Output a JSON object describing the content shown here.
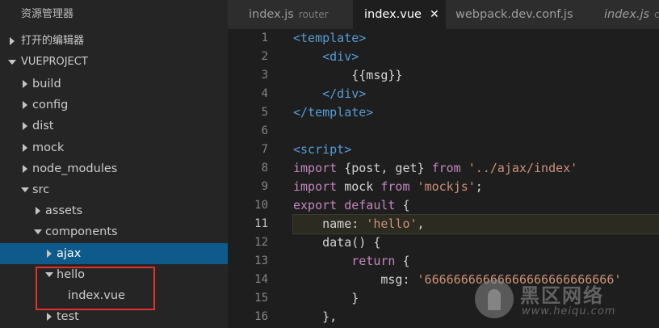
{
  "sidebar": {
    "title": "资源管理器",
    "open_editors": "打开的编辑器",
    "project": "VUEPROJECT",
    "tree": [
      {
        "label": "build",
        "state": "collapsed"
      },
      {
        "label": "config",
        "state": "collapsed"
      },
      {
        "label": "dist",
        "state": "collapsed"
      },
      {
        "label": "mock",
        "state": "collapsed"
      },
      {
        "label": "node_modules",
        "state": "collapsed"
      },
      {
        "label": "src",
        "state": "expanded"
      },
      {
        "label": "assets",
        "state": "collapsed"
      },
      {
        "label": "components",
        "state": "expanded"
      },
      {
        "label": "ajax",
        "state": "collapsed",
        "selected": true
      },
      {
        "label": "hello",
        "state": "expanded"
      },
      {
        "label": "index.vue",
        "state": "file"
      },
      {
        "label": "test",
        "state": "collapsed"
      }
    ]
  },
  "tabs": [
    {
      "label": "index.js",
      "desc": "router"
    },
    {
      "label": "index.vue",
      "close": "✕",
      "active": true
    },
    {
      "label": "webpack.dev.conf.js"
    },
    {
      "label": "index.js",
      "desc": "co"
    }
  ],
  "editor": {
    "current_line": 11,
    "lines": [
      {
        "n": "1",
        "t": [
          [
            "tag",
            "<template>"
          ]
        ]
      },
      {
        "n": "2",
        "t": [
          [
            "plain",
            "    "
          ],
          [
            "tag",
            "<div>"
          ]
        ]
      },
      {
        "n": "3",
        "t": [
          [
            "plain",
            "        {{msg}}"
          ]
        ]
      },
      {
        "n": "4",
        "t": [
          [
            "plain",
            "    "
          ],
          [
            "tag",
            "</div>"
          ]
        ]
      },
      {
        "n": "5",
        "t": [
          [
            "tag",
            "</template>"
          ]
        ]
      },
      {
        "n": "6",
        "t": []
      },
      {
        "n": "7",
        "t": [
          [
            "tag",
            "<script>"
          ]
        ]
      },
      {
        "n": "8",
        "t": [
          [
            "kw",
            "import"
          ],
          [
            "plain",
            " {post, get} "
          ],
          [
            "kw",
            "from"
          ],
          [
            "plain",
            " "
          ],
          [
            "str",
            "'../ajax/index'"
          ]
        ]
      },
      {
        "n": "9",
        "t": [
          [
            "kw",
            "import"
          ],
          [
            "plain",
            " mock "
          ],
          [
            "kw",
            "from"
          ],
          [
            "plain",
            " "
          ],
          [
            "str",
            "'mockjs'"
          ],
          [
            "plain",
            ";"
          ]
        ]
      },
      {
        "n": "10",
        "t": [
          [
            "kw",
            "export"
          ],
          [
            "plain",
            " "
          ],
          [
            "kw",
            "default"
          ],
          [
            "plain",
            " {"
          ]
        ]
      },
      {
        "n": "11",
        "t": [
          [
            "plain",
            "    name: "
          ],
          [
            "str",
            "'hello'"
          ],
          [
            "plain",
            ","
          ]
        ]
      },
      {
        "n": "12",
        "t": [
          [
            "plain",
            "    data() {"
          ]
        ]
      },
      {
        "n": "13",
        "t": [
          [
            "plain",
            "        "
          ],
          [
            "ctrl",
            "return"
          ],
          [
            "plain",
            " {"
          ]
        ]
      },
      {
        "n": "14",
        "t": [
          [
            "plain",
            "            msg: "
          ],
          [
            "str",
            "'66666666666666666666666666'"
          ]
        ]
      },
      {
        "n": "15",
        "t": [
          [
            "plain",
            "        }"
          ]
        ]
      },
      {
        "n": "16",
        "t": [
          [
            "plain",
            "    },"
          ]
        ]
      }
    ]
  },
  "watermark": {
    "text": "黑区网络",
    "sub": "www.heiqu.com"
  },
  "colors": {
    "selected": "#0e5a8a",
    "highlight_box": "#e0312b",
    "tag": "#569cd6",
    "keyword": "#c586c0",
    "string": "#ce9178"
  }
}
